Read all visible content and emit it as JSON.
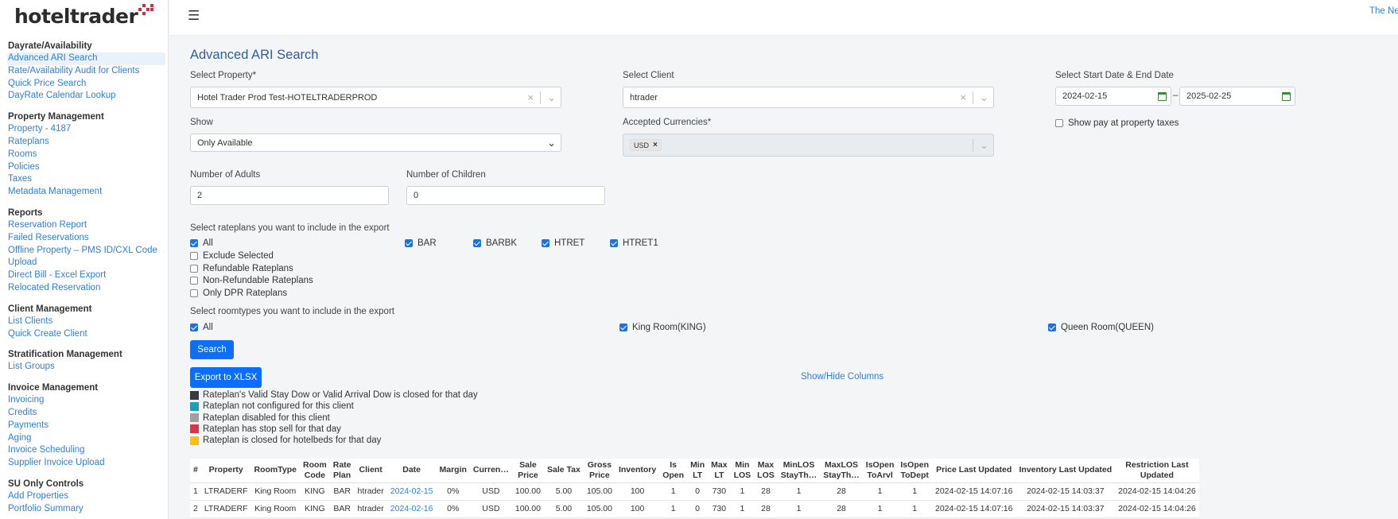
{
  "logo": {
    "text": "hoteltrader"
  },
  "sidebar": {
    "sections": [
      {
        "title": "Dayrate/Availability",
        "items": [
          {
            "label": "Advanced ARI Search",
            "active": true
          },
          {
            "label": "Rate/Availability Audit for Clients"
          },
          {
            "label": "Quick Price Search"
          },
          {
            "label": "DayRate Calendar Lookup"
          }
        ]
      },
      {
        "title": "Property Management",
        "items": [
          {
            "label": "Property - 4187"
          },
          {
            "label": "Rateplans"
          },
          {
            "label": "Rooms"
          },
          {
            "label": "Policies"
          },
          {
            "label": "Taxes"
          },
          {
            "label": "Metadata Management"
          }
        ]
      },
      {
        "title": "Reports",
        "items": [
          {
            "label": "Reservation Report"
          },
          {
            "label": "Failed Reservations"
          },
          {
            "label": "Offline Property – PMS ID/CXL Code"
          },
          {
            "label": "Upload"
          },
          {
            "label": "Direct Bill - Excel Export"
          },
          {
            "label": "Relocated Reservation"
          }
        ]
      },
      {
        "title": "Client Management",
        "items": [
          {
            "label": "List Clients"
          },
          {
            "label": "Quick Create Client"
          }
        ]
      },
      {
        "title": "Stratification Management",
        "items": [
          {
            "label": "List Groups"
          }
        ]
      },
      {
        "title": "Invoice Management",
        "items": [
          {
            "label": "Invoicing"
          },
          {
            "label": "Credits"
          },
          {
            "label": "Payments"
          },
          {
            "label": "Aging"
          },
          {
            "label": "Invoice Scheduling"
          },
          {
            "label": "Supplier Invoice Upload"
          }
        ]
      },
      {
        "title": "SU Only Controls",
        "items": [
          {
            "label": "Add Properties"
          },
          {
            "label": "Portfolio Summary"
          }
        ]
      }
    ]
  },
  "topbar": {
    "hamburger_icon": "menu-icon",
    "right_link": "The Ne"
  },
  "page": {
    "title": "Advanced ARI Search"
  },
  "form": {
    "property_label": "Select Property*",
    "property_value": "Hotel Trader Prod Test-HOTELTRADERPROD",
    "client_label": "Select Client",
    "client_value": "htrader",
    "dates_label": "Select Start Date & End Date",
    "start_date": "2024-02-15",
    "date_sep": "–",
    "end_date": "2025-02-25",
    "show_pay_label": "Show pay at property taxes",
    "show_label": "Show",
    "show_value": "Only Available",
    "currencies_label": "Accepted Currencies*",
    "currency_chip": "USD",
    "adults_label": "Number of Adults",
    "adults_value": "2",
    "children_label": "Number of Children",
    "children_value": "0",
    "rateplans_label": "Select rateplans you want to include in the export",
    "rateplan_options": [
      "All",
      "Exclude Selected",
      "Refundable Rateplans",
      "Non-Refundable Rateplans",
      "Only DPR Rateplans"
    ],
    "rateplan_codes": [
      "BAR",
      "BARBK",
      "HTRET",
      "HTRET1"
    ],
    "roomtypes_label": "Select roomtypes you want to include in the export",
    "roomtypes": [
      "All",
      "King Room(KING)",
      "Queen Room(QUEEN)"
    ],
    "search_button": "Search",
    "export_button": "Export to XLSX",
    "show_hide_columns": "Show/Hide Columns"
  },
  "legend": [
    {
      "color": "#343a40",
      "text": "Rateplan's Valid Stay Dow or Valid Arrival Dow is closed for that day"
    },
    {
      "color": "#17a2b8",
      "text": "Rateplan not configured for this client"
    },
    {
      "color": "#a0a0a0",
      "text": "Rateplan disabled for this client"
    },
    {
      "color": "#dc3545",
      "text": "Rateplan has stop sell for that day"
    },
    {
      "color": "#ffc107",
      "text": "Rateplan is closed for hotelbeds for that day"
    }
  ],
  "table": {
    "headers": [
      [
        "#"
      ],
      [
        "Property"
      ],
      [
        "RoomType"
      ],
      [
        "Room",
        "Code"
      ],
      [
        "Rate",
        "Plan"
      ],
      [
        "Client"
      ],
      [
        "Date"
      ],
      [
        "Margin"
      ],
      [
        "Curren…"
      ],
      [
        "Sale",
        "Price"
      ],
      [
        "Sale Tax"
      ],
      [
        "Gross",
        "Price"
      ],
      [
        "Inventory"
      ],
      [
        "Is",
        "Open"
      ],
      [
        "Min",
        "LT"
      ],
      [
        "Max",
        "LT"
      ],
      [
        "Min",
        "LOS"
      ],
      [
        "Max",
        "LOS"
      ],
      [
        "MinLOS",
        "StayTh…"
      ],
      [
        "MaxLOS",
        "StayTh…"
      ],
      [
        "IsOpen",
        "ToArvl"
      ],
      [
        "IsOpen",
        "ToDept"
      ],
      [
        "Price Last Updated"
      ],
      [
        "Inventory Last Updated"
      ],
      [
        "Restriction Last",
        "Updated"
      ]
    ],
    "rows": [
      [
        "1",
        "LTRADERF",
        "King Room",
        "KING",
        "BAR",
        "htrader",
        "2024-02-15",
        "0%",
        "USD",
        "100.00",
        "5.00",
        "105.00",
        "100",
        "1",
        "0",
        "730",
        "1",
        "28",
        "1",
        "28",
        "1",
        "1",
        "2024-02-15 14:07:16",
        "2024-02-15 14:03:37",
        "2024-02-15 14:04:26"
      ],
      [
        "2",
        "LTRADERF",
        "King Room",
        "KING",
        "BAR",
        "htrader",
        "2024-02-16",
        "0%",
        "USD",
        "100.00",
        "5.00",
        "105.00",
        "100",
        "1",
        "0",
        "730",
        "1",
        "28",
        "1",
        "28",
        "1",
        "1",
        "2024-02-15 14:07:16",
        "2024-02-15 14:03:37",
        "2024-02-15 14:04:26"
      ]
    ]
  }
}
